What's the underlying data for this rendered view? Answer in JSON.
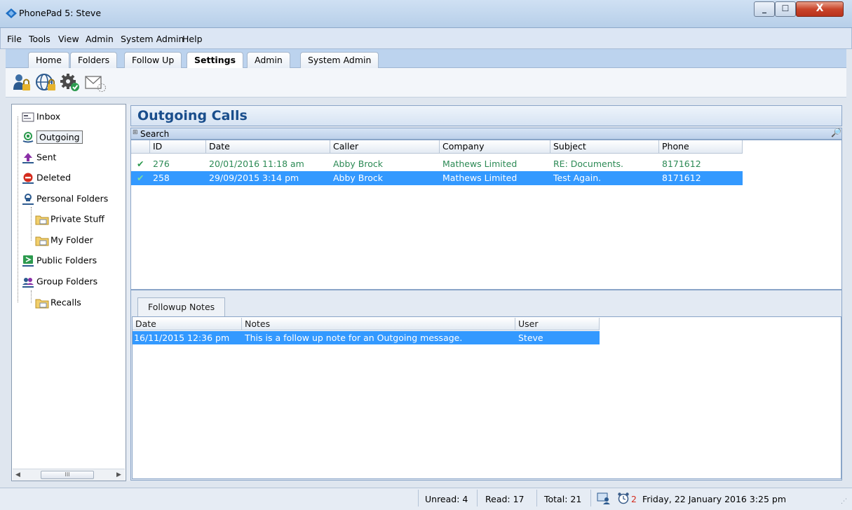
{
  "window": {
    "title": "PhonePad 5: Steve",
    "close_glyph": "X",
    "minimize_glyph": "_",
    "maximize_glyph": "☐"
  },
  "menu": [
    "File",
    "Tools",
    "View",
    "Admin",
    "System Admin",
    "Help"
  ],
  "tabs": [
    {
      "label": "Home",
      "active": false
    },
    {
      "label": "Folders",
      "active": false
    },
    {
      "label": "Follow Up",
      "active": false
    },
    {
      "label": "Settings",
      "active": true
    },
    {
      "label": "Admin",
      "active": false
    },
    {
      "label": "System Admin",
      "active": false
    }
  ],
  "toolbar": {
    "icons": [
      "user-lock-icon",
      "globe-lock-icon",
      "gear-check-icon",
      "envelope-icon"
    ]
  },
  "sidebar": {
    "items": [
      {
        "label": "Inbox",
        "icon": "inbox-icon"
      },
      {
        "label": "Outgoing",
        "icon": "outgoing-icon",
        "selected": true
      },
      {
        "label": "Sent",
        "icon": "sent-icon"
      },
      {
        "label": "Deleted",
        "icon": "deleted-icon"
      },
      {
        "label": "Personal Folders",
        "icon": "personal-folders-icon"
      },
      {
        "label": "Private Stuff",
        "icon": "folder-icon"
      },
      {
        "label": "My Folder",
        "icon": "folder-icon"
      },
      {
        "label": "Public Folders",
        "icon": "public-folders-icon"
      },
      {
        "label": "Group Folders",
        "icon": "group-folders-icon"
      },
      {
        "label": "Recalls",
        "icon": "folder-icon"
      }
    ],
    "scroll_thumb": "III"
  },
  "main": {
    "title": "Outgoing Calls",
    "search_label": "Search",
    "columns": [
      "ID",
      "Date",
      "Caller",
      "Company",
      "Subject",
      "Phone"
    ],
    "rows": [
      {
        "id": "276",
        "date": "20/01/2016 11:18 am",
        "caller": "Abby Brock",
        "company": "Mathews Limited",
        "subject": "RE: Documents.",
        "phone": "8171612",
        "selected": false
      },
      {
        "id": "258",
        "date": "29/09/2015 3:14 pm",
        "caller": "Abby Brock",
        "company": "Mathews Limited",
        "subject": "Test Again.",
        "phone": "8171612",
        "selected": true
      }
    ]
  },
  "followup": {
    "tab_label": "Followup Notes",
    "columns": [
      "Date",
      "Notes",
      "User"
    ],
    "rows": [
      {
        "date": "16/11/2015 12:36 pm",
        "notes": "This is a follow up note for an Outgoing message.",
        "user": "Steve"
      }
    ]
  },
  "status": {
    "unread": "Unread: 4",
    "read": "Read: 17",
    "total": "Total: 21",
    "alarm_count": "2",
    "datetime": "Friday, 22 January 2016  3:25 pm"
  }
}
